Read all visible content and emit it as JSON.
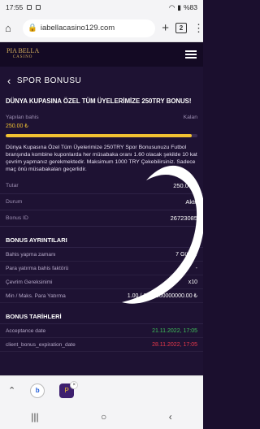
{
  "status": {
    "time": "17:55",
    "battery": "%83"
  },
  "browser": {
    "url": "iabellacasino129.com",
    "tab_count": "2"
  },
  "site": {
    "logo_main": "PIA BELLA",
    "logo_sub": "CASINO"
  },
  "page": {
    "back_title": "SPOR BONUSU"
  },
  "bonus": {
    "title": "DÜNYA KUPASINA ÖZEL TÜM ÜYELERİMİZE 250TRY BONUS!",
    "bet_label": "Yapılan bahis",
    "bet_right": "Kalan",
    "bet_value": "250.00 ₺",
    "progress": 0.97,
    "description": "Dünya Kupasına Özel Tüm Üyelerimize 250TRY Spor Bonusunuzu Futbol branşında kombine kuponlarda her müsabaka oranı 1.60 olacak şekilde 10 kat çevrim yapmanız gerekmektedir. Maksimum 1000 TRY Çekebilirsiniz. Sadece maç önü müsabakaları geçerlidir.",
    "amount_label": "Tutar",
    "amount_value": "250.00 ₺",
    "status_label": "Durum",
    "status_value": "Aktif",
    "id_label": "Bonus ID",
    "id_value": "26723085"
  },
  "details": {
    "header": "BONUS AYRINTILARI",
    "rows": [
      {
        "k": "Bahis yapma zamanı",
        "v": "7 Günler"
      },
      {
        "k": "Para yatırma bahis faktörü",
        "v": "-"
      },
      {
        "k": "Çevrim Gereksinimi",
        "v": "x10"
      },
      {
        "k": "Min / Maks. Para Yatırma",
        "v": "1.00 / 1000000000000.00 ₺"
      }
    ]
  },
  "dates": {
    "header": "BONUS TARİHLERİ",
    "rows": [
      {
        "k": "Acceptance date",
        "v": "21.11.2022, 17:05"
      },
      {
        "k": "client_bonus_expiration_date",
        "v": "28.11.2022, 17:05"
      }
    ]
  },
  "colors": {
    "accent": "#f1c232",
    "green": "#3fc25a",
    "red": "#e6384a",
    "bg": "#1e1233"
  },
  "bottom": {
    "chip_b": "b",
    "chip_p": "P",
    "close": "×"
  }
}
